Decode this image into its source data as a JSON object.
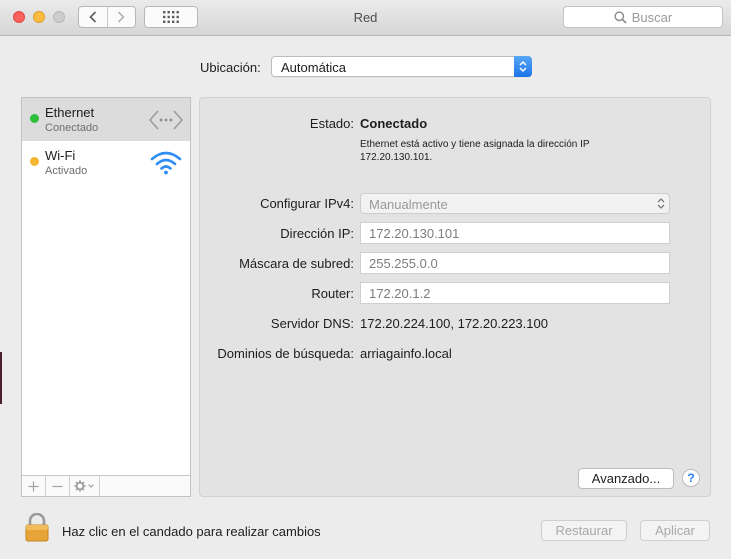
{
  "window": {
    "title": "Red"
  },
  "toolbar": {
    "search_placeholder": "Buscar"
  },
  "location": {
    "label": "Ubicación:",
    "value": "Automática"
  },
  "services": [
    {
      "name": "Ethernet",
      "status": "Conectado",
      "status_color": "#2dbe3c",
      "icon": "ethernet-icon",
      "selected": true
    },
    {
      "name": "Wi-Fi",
      "status": "Activado",
      "status_color": "#f5b731",
      "icon": "wifi-icon",
      "selected": false
    }
  ],
  "detail": {
    "status_label": "Estado:",
    "status_value": "Conectado",
    "status_description": "Ethernet está activo y tiene asignada la dirección IP 172.20.130.101.",
    "ipv4_label": "Configurar IPv4:",
    "ipv4_value": "Manualmente",
    "ip_label": "Dirección IP:",
    "ip_value": "172.20.130.101",
    "mask_label": "Máscara de subred:",
    "mask_value": "255.255.0.0",
    "router_label": "Router:",
    "router_value": "172.20.1.2",
    "dns_label": "Servidor DNS:",
    "dns_value": "172.20.224.100, 172.20.223.100",
    "domains_label": "Dominios de búsqueda:",
    "domains_value": "arriagainfo.local",
    "advanced_label": "Avanzado...",
    "help_label": "?"
  },
  "footer": {
    "lock_text": "Haz clic en el candado para realizar cambios",
    "revert_label": "Restaurar",
    "apply_label": "Aplicar"
  }
}
